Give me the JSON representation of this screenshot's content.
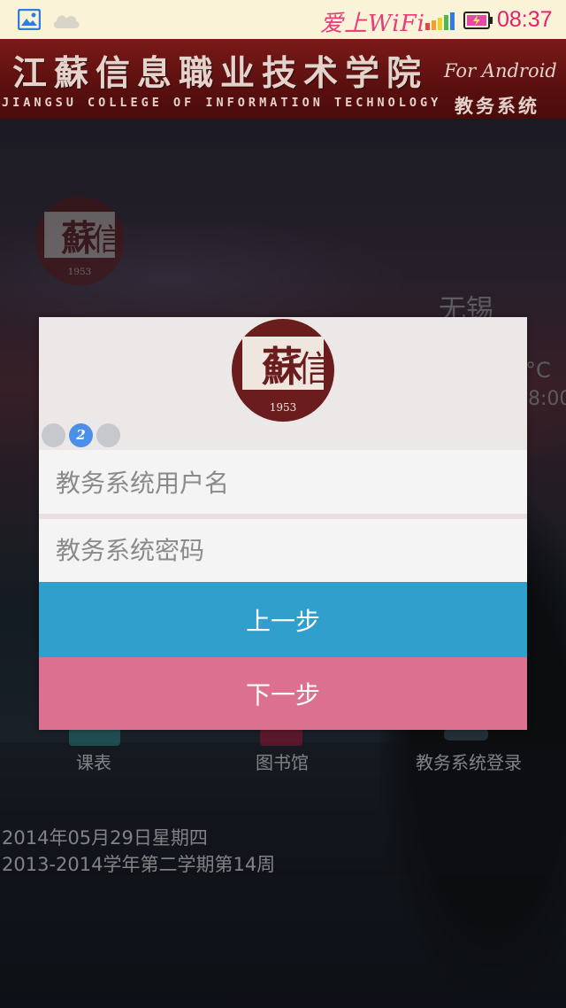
{
  "status_bar": {
    "wifi_label": "爱上WiFi",
    "time": "08:37",
    "colors": {
      "bar": "#fbf3d8",
      "accent": "#e4206c"
    }
  },
  "header": {
    "title": "江蘇信息職业技术学院",
    "subtitle": "JIANGSU COLLEGE OF INFORMATION TECHNOLOGY",
    "platform": "For Android",
    "system_name": "教务系统",
    "seal_year": "1953"
  },
  "weather": {
    "city": "无锡",
    "temp_fragment": "°C",
    "time_fragment": "8:00"
  },
  "apps": [
    {
      "label": "课表"
    },
    {
      "label": "图书馆"
    },
    {
      "label": "教务系统登录"
    }
  ],
  "date_info": {
    "date": "2014年05月29日星期四",
    "term": "2013-2014学年第二学期第14周"
  },
  "dialog": {
    "seal_year": "1953",
    "step_indicator": {
      "current": "2",
      "total": 3
    },
    "username": {
      "placeholder": "教务系统用户名",
      "value": ""
    },
    "password": {
      "placeholder": "教务系统密码",
      "value": ""
    },
    "prev_button": "上一步",
    "next_button": "下一步",
    "colors": {
      "prev": "#309fcb",
      "next": "#dc708f",
      "active_dot": "#4a8fe8"
    }
  }
}
